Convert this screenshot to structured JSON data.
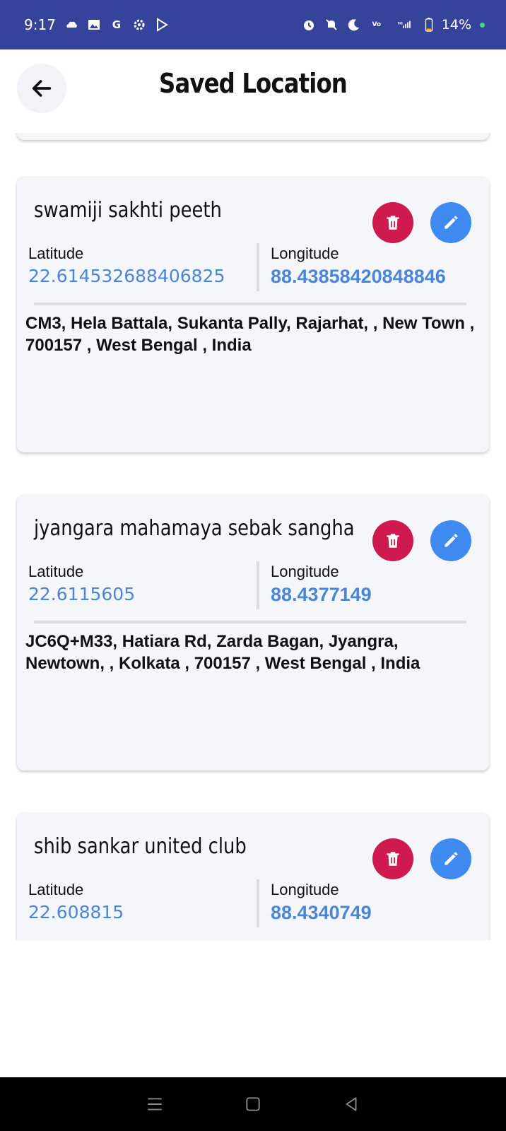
{
  "status_bar": {
    "time": "9:17",
    "battery": "14%",
    "left_icons": [
      "cloud-icon",
      "photo-icon",
      "google-icon",
      "settings-icon",
      "play-store-icon"
    ],
    "right_icons": [
      "alarm-icon",
      "mute-icon",
      "do-not-disturb-icon",
      "volte-icon",
      "5g-signal-icon",
      "battery-icon"
    ],
    "volte_label": "Vo",
    "network_label": "5G"
  },
  "header": {
    "title": "Saved Location",
    "back_icon": "arrow-left-icon"
  },
  "labels": {
    "latitude": "Latitude",
    "longitude": "Longitude"
  },
  "locations": [
    {
      "name": "swamiji sakhti peeth",
      "latitude": "22.614532688406825",
      "longitude": "88.43858420848846",
      "address": "CM3, Hela Battala, Sukanta Pally, Rajarhat,  , New Town , 700157 , West Bengal , India"
    },
    {
      "name": "jyangara mahamaya sebak sangha",
      "latitude": "22.6115605",
      "longitude": "88.4377149",
      "address": "JC6Q+M33, Hatiara Rd, Zarda Bagan, Jyangra, Newtown,  , Kolkata , 700157 , West Bengal , India"
    },
    {
      "name": "shib sankar united club",
      "latitude": "22.608815",
      "longitude": "88.4340749",
      "address": ""
    }
  ],
  "colors": {
    "status_bar": "#36439a",
    "delete_button": "#cf1a50",
    "edit_button": "#3e8af0",
    "coordinate_text": "#4a86d8",
    "card_background": "#f5f6f9"
  },
  "nav": {
    "icons": [
      "menu-icon",
      "home-square-icon",
      "back-triangle-icon"
    ]
  }
}
